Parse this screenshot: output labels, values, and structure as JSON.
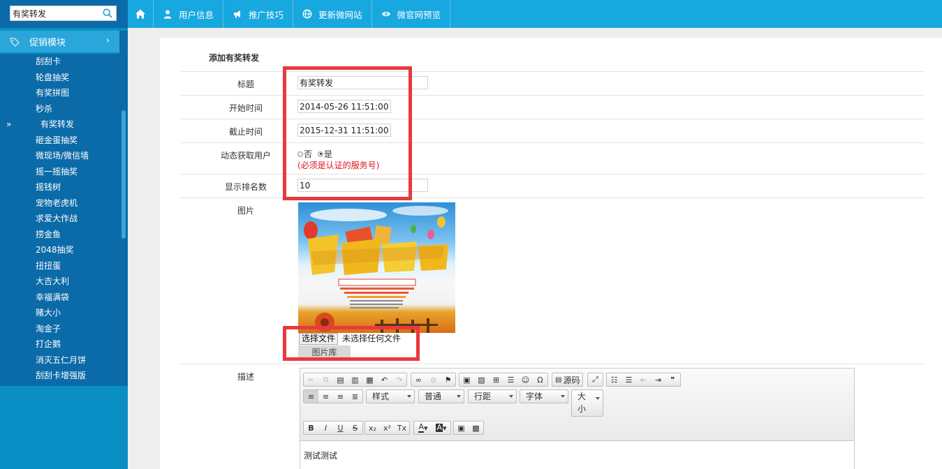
{
  "sidebar": {
    "search_value": "有奖转发",
    "module_label": "促销模块",
    "module_chevron": "›",
    "active_arrow": "»",
    "items": [
      {
        "label": "刮刮卡"
      },
      {
        "label": "轮盘抽奖"
      },
      {
        "label": "有奖拼图"
      },
      {
        "label": "秒杀"
      },
      {
        "label": "有奖转发"
      },
      {
        "label": "砸金蛋抽奖"
      },
      {
        "label": "微现场/微信墙"
      },
      {
        "label": "摇一摇抽奖"
      },
      {
        "label": "摇钱树"
      },
      {
        "label": "宠物老虎机"
      },
      {
        "label": "求爱大作战"
      },
      {
        "label": "捞金鱼"
      },
      {
        "label": "2048抽奖"
      },
      {
        "label": "扭扭蛋"
      },
      {
        "label": "大吉大利"
      },
      {
        "label": "幸福满袋"
      },
      {
        "label": "赌大小"
      },
      {
        "label": "淘金子"
      },
      {
        "label": "打企鹅"
      },
      {
        "label": "消灭五仁月饼"
      },
      {
        "label": "刮刮卡增强版"
      }
    ]
  },
  "topnav": {
    "items": [
      {
        "label": "用户信息"
      },
      {
        "label": "推广技巧"
      },
      {
        "label": "更新微网站"
      },
      {
        "label": "微官网预览"
      }
    ]
  },
  "form": {
    "title": "添加有奖转发",
    "fields": {
      "title_label": "标题",
      "title_value": "有奖转发",
      "start_label": "开始时间",
      "start_value": "2014-05-26 11:51:00",
      "end_label": "截止时间",
      "end_value": "2015-12-31 11:51:00",
      "dynamic_label": "动态获取用户",
      "radio_no": "否",
      "radio_yes": "是",
      "dynamic_note": "(必须是认证的服务号)",
      "rank_label": "显示排名数",
      "rank_value": "10",
      "image_label": "图片",
      "file_button": "选择文件",
      "file_status": "未选择任何文件",
      "gallery_button": "图片库",
      "desc_label": "描述"
    }
  },
  "editor": {
    "source_label": "源码",
    "style_label": "样式",
    "format_label": "普通",
    "line_height_label": "行距",
    "font_label": "字体",
    "size_label_1": "大",
    "size_label_2": "小",
    "content": "测试测试"
  },
  "colors": {
    "sidebar_bg": "#0b6aa8",
    "topnav_bg": "#16a8df",
    "highlight_border": "#e8393f",
    "note_red": "#d9141b"
  }
}
